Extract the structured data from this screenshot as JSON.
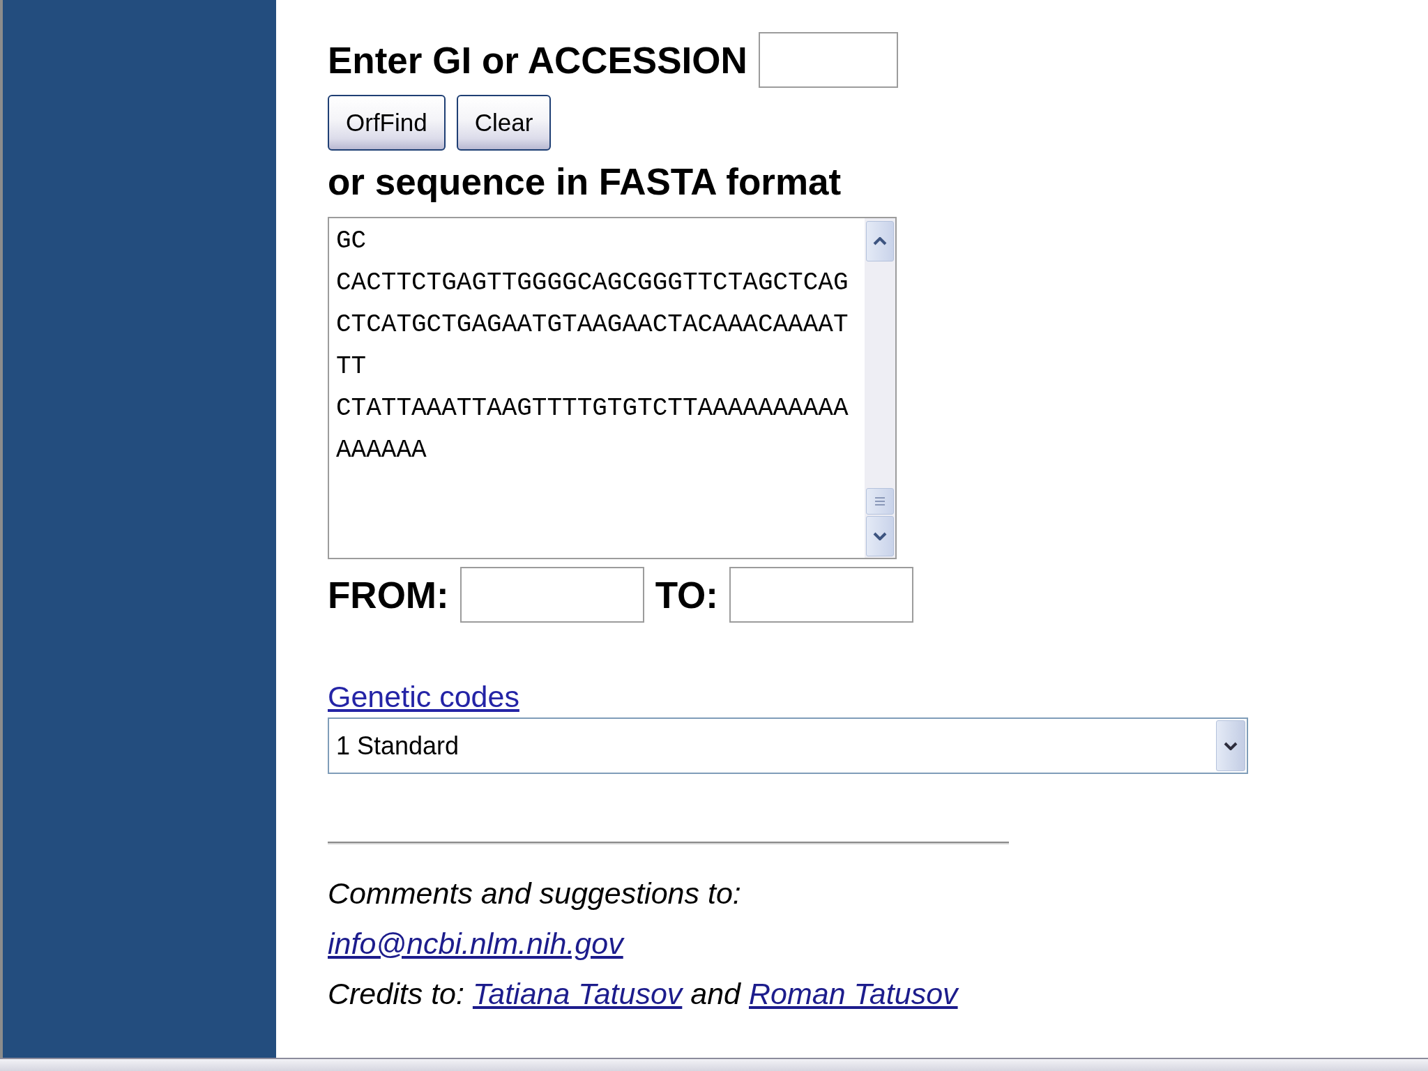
{
  "accession": {
    "label": "Enter GI or ACCESSION"
  },
  "buttons": [
    "OrfFind",
    "Clear"
  ],
  "sequence": {
    "label": "or sequence in FASTA format",
    "value": "GC\nCACTTCTGAGTTGGGGCAGCGGGTTCTAGCTCAG\nCTCATGCTGAGAATGTAAGAACTACAAACAAAAT\nTT\nCTATTAAATTAAGTTTTGTGTCTTAAAAAAAAAA\nAAAAAA"
  },
  "range": [
    {
      "label": "FROM:"
    },
    {
      "label": "TO:"
    }
  ],
  "genetic_code": {
    "link": "Genetic codes",
    "value": "1 Standard"
  },
  "footer": {
    "comment": "Comments and suggestions to:",
    "email": "info@ncbi.nlm.nih.gov",
    "credits": {
      "label": "Credits to:",
      "authors": [
        "Tatiana Tatusov",
        "Roman Tatusov"
      ],
      "conjunction": "and"
    }
  }
}
